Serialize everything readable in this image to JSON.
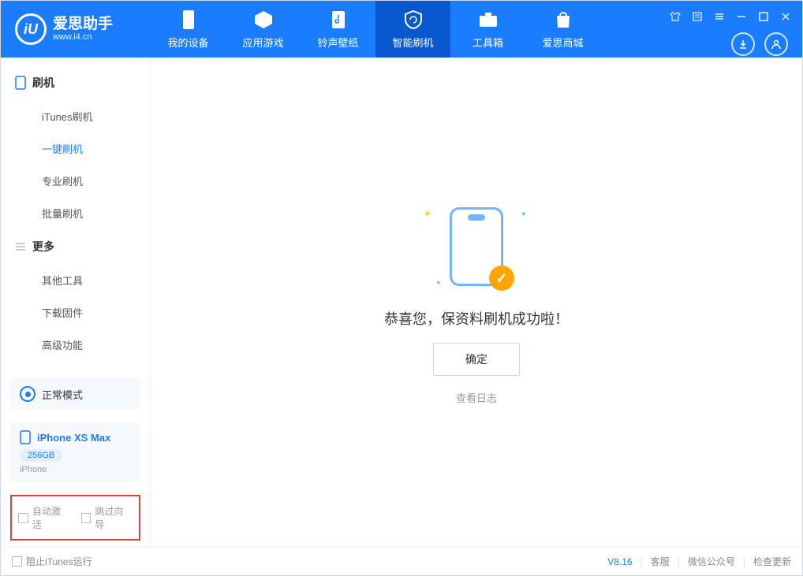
{
  "app": {
    "name": "爱思助手",
    "domain": "www.i4.cn",
    "logo_letter": "iU"
  },
  "tabs": [
    {
      "label": "我的设备"
    },
    {
      "label": "应用游戏"
    },
    {
      "label": "铃声壁纸"
    },
    {
      "label": "智能刷机"
    },
    {
      "label": "工具箱"
    },
    {
      "label": "爱思商城"
    }
  ],
  "sidebar": {
    "group1": "刷机",
    "items1": [
      {
        "label": "iTunes刷机"
      },
      {
        "label": "一键刷机"
      },
      {
        "label": "专业刷机"
      },
      {
        "label": "批量刷机"
      }
    ],
    "group2": "更多",
    "items2": [
      {
        "label": "其他工具"
      },
      {
        "label": "下载固件"
      },
      {
        "label": "高级功能"
      }
    ]
  },
  "mode": {
    "label": "正常模式"
  },
  "device": {
    "name": "iPhone XS Max",
    "storage": "256GB",
    "type": "iPhone"
  },
  "checks": {
    "auto_activate": "自动激活",
    "skip_guide": "跳过向导"
  },
  "result": {
    "message": "恭喜您，保资料刷机成功啦！",
    "ok": "确定",
    "view_log": "查看日志"
  },
  "footer": {
    "block_itunes": "阻止iTunes运行",
    "version": "V8.16",
    "support": "客服",
    "wechat": "微信公众号",
    "update": "检查更新"
  }
}
